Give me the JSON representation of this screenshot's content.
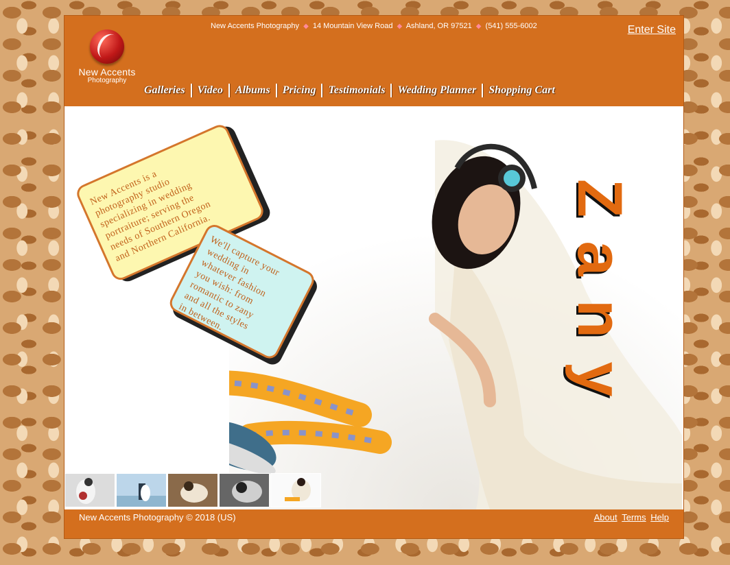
{
  "header": {
    "logo_name": "New Accents",
    "logo_sub": "Photography",
    "contact": {
      "business": "New Accents Photography",
      "address": "14 Mountain View Road",
      "city": "Ashland, OR 97521",
      "phone": "(541) 555-6002"
    },
    "enter_site": "Enter Site"
  },
  "nav": {
    "items": [
      {
        "label": "Galleries"
      },
      {
        "label": "Video"
      },
      {
        "label": "Albums"
      },
      {
        "label": "Pricing"
      },
      {
        "label": "Testimonials"
      },
      {
        "label": "Wedding Planner"
      },
      {
        "label": "Shopping Cart"
      }
    ]
  },
  "hero": {
    "bubble1": "New Accents is a\nphotography studio\nspecializing in wedding\nportraiture; serving the\nneeds of Southern Oregon\nand Northern California.",
    "bubble2": "We'll capture your\n wedding in\n whatever fashion\n you wish: from\n romantic to zany\n and all the styles\n in between.",
    "zany_letters": [
      "Z",
      "a",
      "n",
      "y"
    ]
  },
  "thumbnails": [
    {
      "name": "bride-bouquet"
    },
    {
      "name": "couple-pier"
    },
    {
      "name": "couple-portrait"
    },
    {
      "name": "bride-bw"
    },
    {
      "name": "bride-sneakers"
    }
  ],
  "footer": {
    "copyright": "New Accents Photography © 2018 (US)",
    "links": {
      "about": "About",
      "terms": "Terms",
      "help": "Help"
    }
  },
  "colors": {
    "brand_orange": "#d46f1e",
    "bubble_yellow": "#fdf7b0",
    "bubble_blue": "#cff3f0",
    "accent_text": "#c0601a"
  }
}
